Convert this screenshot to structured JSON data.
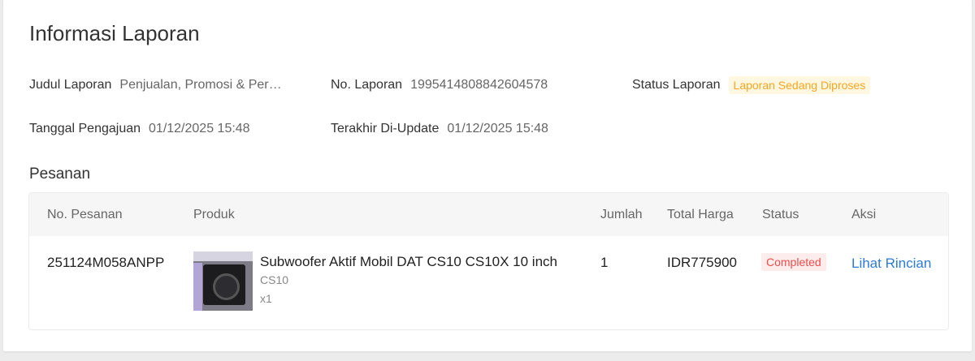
{
  "page": {
    "title": "Informasi Laporan"
  },
  "report": {
    "title_label": "Judul Laporan",
    "title_value": "Penjualan, Promosi & Per…",
    "number_label": "No. Laporan",
    "number_value": "1995414808842604578",
    "status_label": "Status Laporan",
    "status_value": "Laporan Sedang Diproses",
    "submitted_label": "Tanggal Pengajuan",
    "submitted_value": "01/12/2025 15:48",
    "updated_label": "Terakhir Di-Update",
    "updated_value": "01/12/2025 15:48"
  },
  "orders": {
    "section_title": "Pesanan",
    "columns": [
      "No. Pesanan",
      "Produk",
      "Jumlah",
      "Total Harga",
      "Status",
      "Aksi"
    ],
    "rows": [
      {
        "order_no": "251124M058ANPP",
        "product_name": "Subwoofer Aktif Mobil DAT CS10 CS10X 10 inch",
        "product_variant": "CS10",
        "product_qty": "x1",
        "quantity": "1",
        "total": "IDR775900",
        "status": "Completed",
        "action": "Lihat Rincian"
      }
    ]
  },
  "colors": {
    "accent_link": "#2e7bd4",
    "status_processing": "#f5a623",
    "status_completed": "#ee4d4d"
  }
}
